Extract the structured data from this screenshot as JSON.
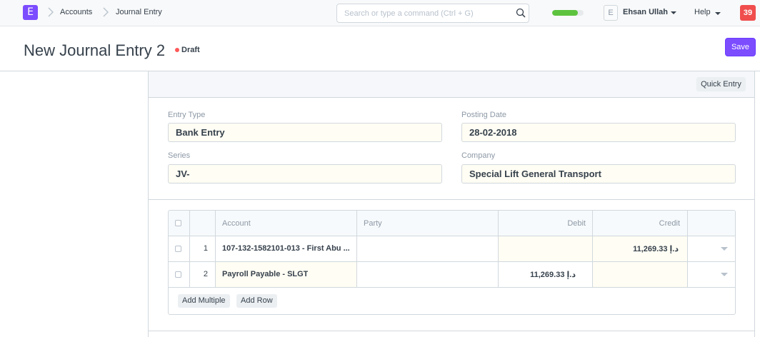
{
  "navbar": {
    "logo_letter": "E",
    "breadcrumbs": [
      "Accounts",
      "Journal Entry"
    ],
    "search_placeholder": "Search or type a command (Ctrl + G)",
    "progress_percent": 82,
    "avatar_letter": "E",
    "user_name": "Ehsan Ullah",
    "help_label": "Help",
    "notification_count": "39"
  },
  "page": {
    "title": "New Journal Entry 2",
    "status": "Draft",
    "save_label": "Save"
  },
  "form": {
    "quick_entry_label": "Quick Entry",
    "fields": {
      "entry_type": {
        "label": "Entry Type",
        "value": "Bank Entry"
      },
      "posting_date": {
        "label": "Posting Date",
        "value": "28-02-2018"
      },
      "series": {
        "label": "Series",
        "value": "JV-"
      },
      "company": {
        "label": "Company",
        "value": "Special Lift General Transport"
      }
    }
  },
  "accounts_table": {
    "columns": {
      "account": "Account",
      "party": "Party",
      "debit": "Debit",
      "credit": "Credit"
    },
    "rows": [
      {
        "idx": "1",
        "account": "107-132-1582101-013 - First Abu ...",
        "party": "",
        "debit": "",
        "credit": "د.إ 11,269.33"
      },
      {
        "idx": "2",
        "account": "Payroll Payable - SLGT",
        "party": "",
        "debit": "د.إ 11,269.33",
        "credit": ""
      }
    ],
    "add_multiple_label": "Add Multiple",
    "add_row_label": "Add Row"
  },
  "colors": {
    "brand": "#7c4dff",
    "notification": "#f04d4d",
    "draft_dot": "#ff5858",
    "progress": "#5dc33f"
  }
}
